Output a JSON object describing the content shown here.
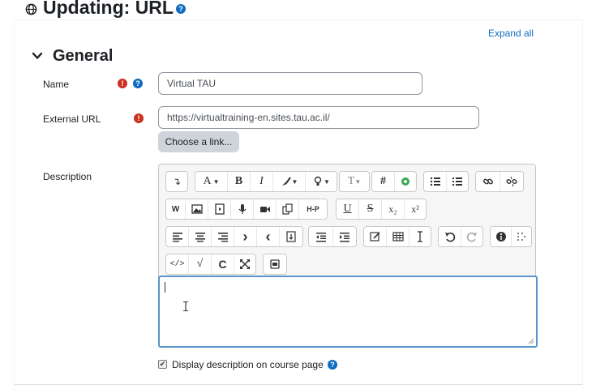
{
  "page": {
    "title": "Updating: URL",
    "globe_icon": "globe-icon",
    "help_icon": "question-circle-icon",
    "accent_color": "#0f6cbf",
    "error_color": "#ca3120"
  },
  "form": {
    "expand_all_label": "Expand all",
    "section_title": "General",
    "name": {
      "label": "Name",
      "value": "Virtual TAU"
    },
    "external_url": {
      "label": "External URL",
      "value": "https://virtualtraining-en.sites.tau.ac.il/",
      "choose_link_label": "Choose a link..."
    },
    "description": {
      "label": "Description"
    },
    "display_description": {
      "label": "Display description on course page",
      "checked": true
    }
  },
  "editor": {
    "toolbar": {
      "row1": [
        "more",
        "font-family",
        "bold",
        "italic",
        "style",
        "paragraph",
        "font-size",
        "hashtag",
        "recycle",
        "bullet-list",
        "numbered-list",
        "link",
        "unlink"
      ],
      "row1_text": {
        "more": "↴",
        "font": "A",
        "bold": "B",
        "italic": "I",
        "hash": "#",
        "para": "T"
      },
      "row2_text": {
        "h5p": "H-P",
        "underline": "U",
        "strike": "S",
        "sub": "x₂",
        "sup": "x²",
        "word": "W"
      },
      "row3_text": {
        "indent_in": "›",
        "indent_out": "‹"
      },
      "row4_text": {
        "code": "</>",
        "equation": "√",
        "copy": "C"
      }
    }
  }
}
